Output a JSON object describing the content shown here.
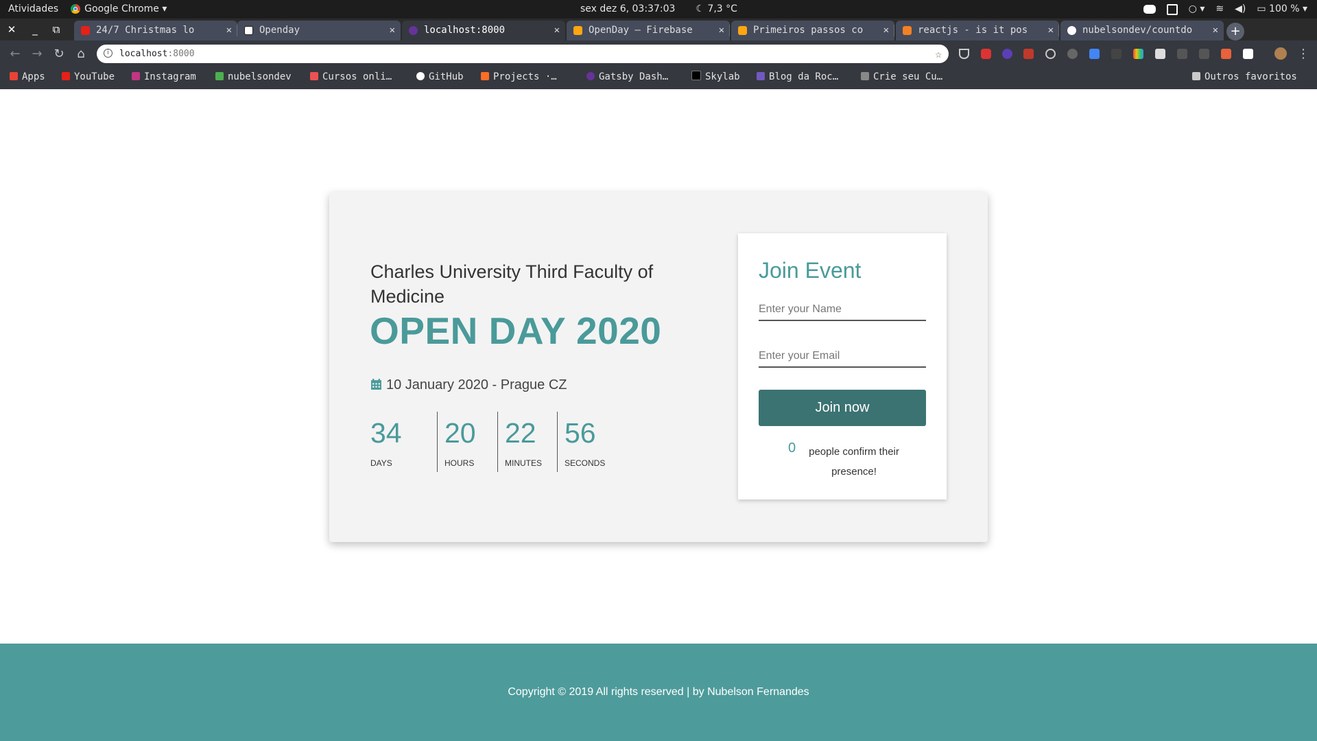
{
  "os": {
    "activities": "Atividades",
    "app_name": "Google Chrome",
    "clock": "sex dez  6, 03:37:03",
    "weather": "7,3 °C",
    "battery": "100 %"
  },
  "tabs": [
    {
      "title": "24/7 Christmas lo",
      "favicon_color": "#e62117",
      "active": false
    },
    {
      "title": "Openday",
      "favicon_color": "#ffffff",
      "active": false
    },
    {
      "title": "localhost:8000",
      "favicon_color": "#663399",
      "active": true
    },
    {
      "title": "OpenDay – Firebase",
      "favicon_color": "#ffa611",
      "active": false
    },
    {
      "title": "Primeiros passos co",
      "favicon_color": "#ffa611",
      "active": false
    },
    {
      "title": "reactjs - is it pos",
      "favicon_color": "#f48024",
      "active": false
    },
    {
      "title": "nubelsondev/countdo",
      "favicon_color": "#ffffff",
      "active": false
    }
  ],
  "toolbar": {
    "url_host": "localhost",
    "url_port": ":8000"
  },
  "bookmarks": [
    {
      "label": "Apps",
      "icon": "apps-grid-icon",
      "color": "#ea4335"
    },
    {
      "label": "YouTube",
      "icon": "youtube-icon",
      "color": "#e62117"
    },
    {
      "label": "Instagram",
      "icon": "instagram-icon",
      "color": "#c13584"
    },
    {
      "label": "nubelsondev",
      "icon": "profile-icon",
      "color": "#4caf50"
    },
    {
      "label": "Cursos onli…",
      "icon": "udemy-icon",
      "color": "#ec5252"
    },
    {
      "label": "GitHub",
      "icon": "github-icon",
      "color": "#ffffff"
    },
    {
      "label": "Projects ·…",
      "icon": "gitlab-icon",
      "color": "#fc6d26"
    },
    {
      "label": "Gatsby Dash…",
      "icon": "gatsby-icon",
      "color": "#663399"
    },
    {
      "label": "Skylab",
      "icon": "skylab-icon",
      "color": "#000000"
    },
    {
      "label": "Blog da Roc…",
      "icon": "rocketseat-icon",
      "color": "#7159c1"
    },
    {
      "label": "Crie seu Cu…",
      "icon": "cv-icon",
      "color": "#888888"
    }
  ],
  "other_bookmarks": "Outros favoritos",
  "event": {
    "subtitle": "Charles University Third Faculty of Medicine",
    "title": "OPEN DAY 2020",
    "date": "10 January 2020 - Prague CZ"
  },
  "countdown": [
    {
      "value": "34",
      "label": "DAYS"
    },
    {
      "value": "20",
      "label": "HOURS"
    },
    {
      "value": "22",
      "label": "MINUTES"
    },
    {
      "value": "56",
      "label": "SECONDS"
    }
  ],
  "form": {
    "title": "Join Event",
    "name_placeholder": "Enter your Name",
    "email_placeholder": "Enter your Email",
    "name_value": "",
    "email_value": "",
    "button_label": "Join now",
    "confirm_count": "0",
    "confirm_text": "people confirm their presence!"
  },
  "footer": {
    "text": "Copyright © 2019 All rights reserved | by Nubelson Fernandes"
  },
  "colors": {
    "accent": "#4a9a9a",
    "button": "#3b7372",
    "footer": "#4e9b9b",
    "card": "#f3f3f3"
  }
}
